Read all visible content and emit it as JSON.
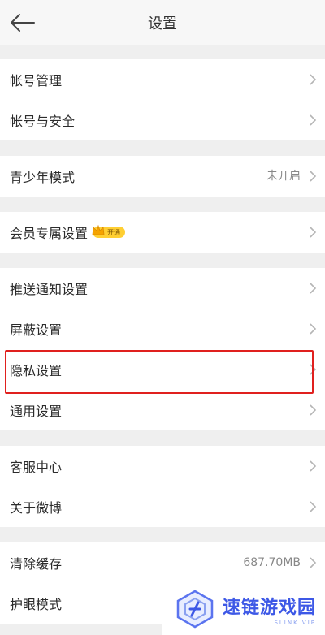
{
  "header": {
    "title": "设置"
  },
  "groups": {
    "account": [
      {
        "label": "帐号管理"
      },
      {
        "label": "帐号与安全"
      }
    ],
    "youth": [
      {
        "label": "青少年模式",
        "value": "未开启"
      }
    ],
    "member": [
      {
        "label": "会员专属设置",
        "badge": "开通"
      }
    ],
    "general": [
      {
        "label": "推送通知设置"
      },
      {
        "label": "屏蔽设置"
      },
      {
        "label": "隐私设置"
      },
      {
        "label": "通用设置"
      }
    ],
    "support": [
      {
        "label": "客服中心"
      },
      {
        "label": "关于微博"
      }
    ],
    "storage": [
      {
        "label": "清除缓存",
        "value": "687.70MB"
      },
      {
        "label": "护眼模式"
      }
    ]
  },
  "watermark": {
    "text_cn": "速链游戏园",
    "text_en": "SLINK VIP"
  },
  "colors": {
    "highlight": "#e0201e",
    "badge": "#ffcf33",
    "watermark": "#3d58e6"
  }
}
